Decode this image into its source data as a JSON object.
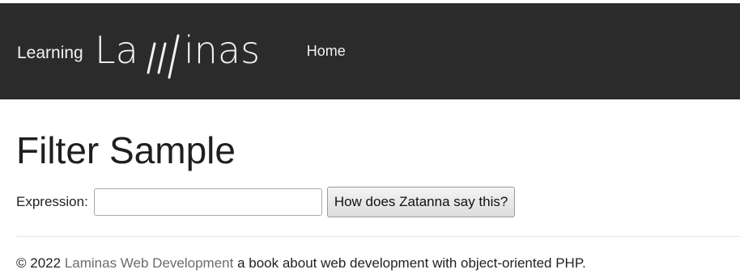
{
  "navbar": {
    "brand_prefix": "Learning",
    "brand_logo_text": "Laminas",
    "home_label": "Home"
  },
  "main": {
    "title": "Filter Sample",
    "expression_label": "Expression:",
    "expression_value": "",
    "expression_placeholder": "",
    "submit_label": "How does Zatanna say this?"
  },
  "footer": {
    "copyright": "© 2022",
    "link_text": "Laminas Web Development",
    "tagline": "a book about web development with object-oriented PHP."
  },
  "colors": {
    "navbar_background": "#2b2b2b",
    "navbar_text": "#f2f2f2",
    "footer_link": "#6b6b6b"
  }
}
